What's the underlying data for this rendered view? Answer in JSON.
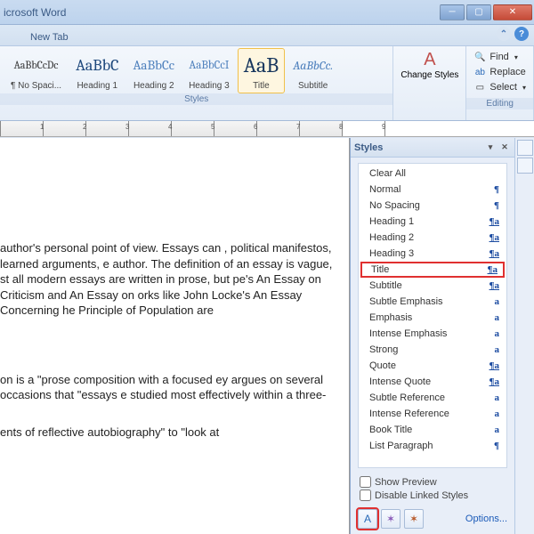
{
  "window": {
    "title": "icrosoft Word"
  },
  "tabs": {
    "newtab": "New Tab"
  },
  "ribbon": {
    "styles_group_label": "Styles",
    "editing_group_label": "Editing",
    "gallery": [
      {
        "preview": "AaBbCcDc",
        "label": "¶ No Spaci...",
        "size": "12px",
        "color": "#333"
      },
      {
        "preview": "AaBbC",
        "label": "Heading 1",
        "size": "18px",
        "color": "#1f497d"
      },
      {
        "preview": "AaBbCc",
        "label": "Heading 2",
        "size": "15px",
        "color": "#4f81bd"
      },
      {
        "preview": "AaBbCcI",
        "label": "Heading 3",
        "size": "13px",
        "color": "#4f81bd"
      },
      {
        "preview": "AaB",
        "label": "Title",
        "size": "24px",
        "color": "#17365d",
        "selected": true
      },
      {
        "preview": "AaBbCc.",
        "label": "Subtitle",
        "size": "14px",
        "color": "#4f81bd",
        "italic": true
      }
    ],
    "change_styles": "Change Styles",
    "find": "Find",
    "replace": "Replace",
    "select": "Select"
  },
  "document": {
    "para1": " author's personal point of view. Essays can , political manifestos, learned arguments, e author. The definition of an essay is vague, st all modern essays are written in prose, but pe's An Essay on Criticism and An Essay on orks like John Locke's An Essay Concerning he Principle of Population are",
    "para2": "on is a \"prose composition with a focused ey argues on several occasions that \"essays e studied most effectively within a three-",
    "para3": "ents of reflective autobiography\" to \"look at"
  },
  "styles_pane": {
    "title": "Styles",
    "list": [
      {
        "name": "Clear All",
        "marker": ""
      },
      {
        "name": "Normal",
        "marker": "¶"
      },
      {
        "name": "No Spacing",
        "marker": "¶"
      },
      {
        "name": "Heading 1",
        "marker": "¶a",
        "link": true
      },
      {
        "name": "Heading 2",
        "marker": "¶a",
        "link": true
      },
      {
        "name": "Heading 3",
        "marker": "¶a",
        "link": true
      },
      {
        "name": "Title",
        "marker": "¶a",
        "link": true,
        "highlighted": true
      },
      {
        "name": "Subtitle",
        "marker": "¶a",
        "link": true
      },
      {
        "name": "Subtle Emphasis",
        "marker": "a"
      },
      {
        "name": "Emphasis",
        "marker": "a"
      },
      {
        "name": "Intense Emphasis",
        "marker": "a"
      },
      {
        "name": "Strong",
        "marker": "a"
      },
      {
        "name": "Quote",
        "marker": "¶a",
        "link": true
      },
      {
        "name": "Intense Quote",
        "marker": "¶a",
        "link": true
      },
      {
        "name": "Subtle Reference",
        "marker": "a"
      },
      {
        "name": "Intense Reference",
        "marker": "a"
      },
      {
        "name": "Book Title",
        "marker": "a"
      },
      {
        "name": "List Paragraph",
        "marker": "¶"
      }
    ],
    "show_preview": "Show Preview",
    "disable_linked": "Disable Linked Styles",
    "options": "Options..."
  }
}
